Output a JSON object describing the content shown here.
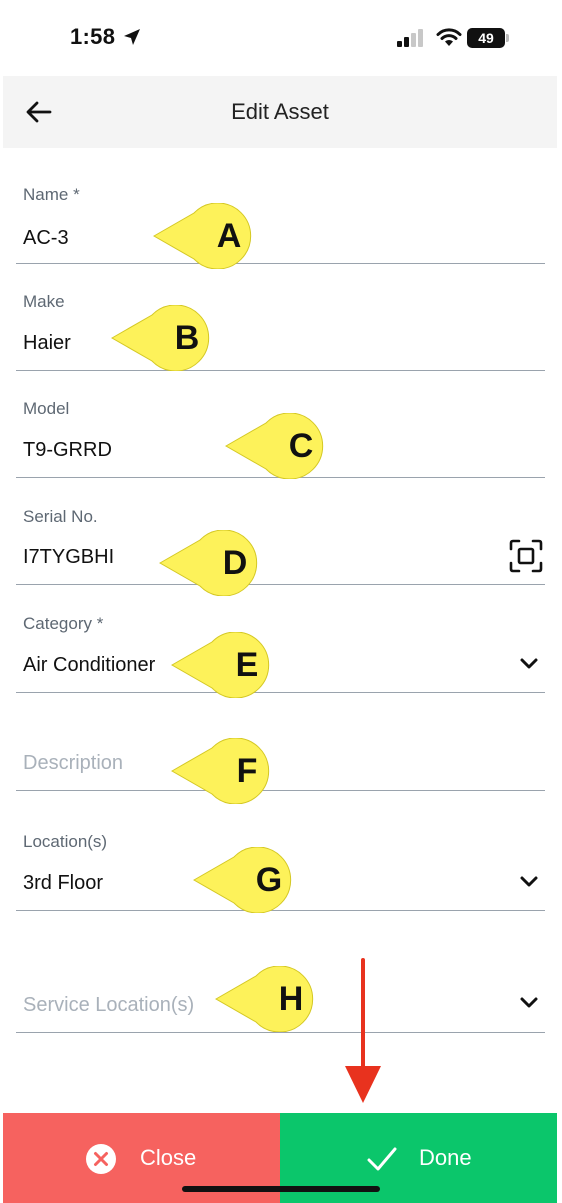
{
  "status_bar": {
    "time": "1:58",
    "battery": "49"
  },
  "header": {
    "title": "Edit Asset",
    "back_icon": "arrow-left-icon"
  },
  "fields": {
    "name": {
      "label": "Name *",
      "value": "AC-3"
    },
    "make": {
      "label": "Make",
      "value": "Haier"
    },
    "model": {
      "label": "Model",
      "value": "T9-GRRD"
    },
    "serial": {
      "label": "Serial No.",
      "value": "I7TYGBHI",
      "icon": "scan-icon"
    },
    "category": {
      "label": "Category *",
      "value": "Air Conditioner",
      "icon": "chevron-down-icon"
    },
    "description": {
      "placeholder": "Description"
    },
    "locations": {
      "label": "Location(s)",
      "value": "3rd Floor",
      "icon": "chevron-down-icon"
    },
    "service_locations": {
      "placeholder": "Service Location(s)",
      "icon": "chevron-down-icon"
    }
  },
  "callouts": [
    "A",
    "B",
    "C",
    "D",
    "E",
    "F",
    "G",
    "H"
  ],
  "footer": {
    "close_label": "Close",
    "done_label": "Done"
  },
  "colors": {
    "close_bg": "#f6625f",
    "done_bg": "#0bc66b",
    "callout_fill": "#fdf25a",
    "arrow": "#e8321e"
  }
}
